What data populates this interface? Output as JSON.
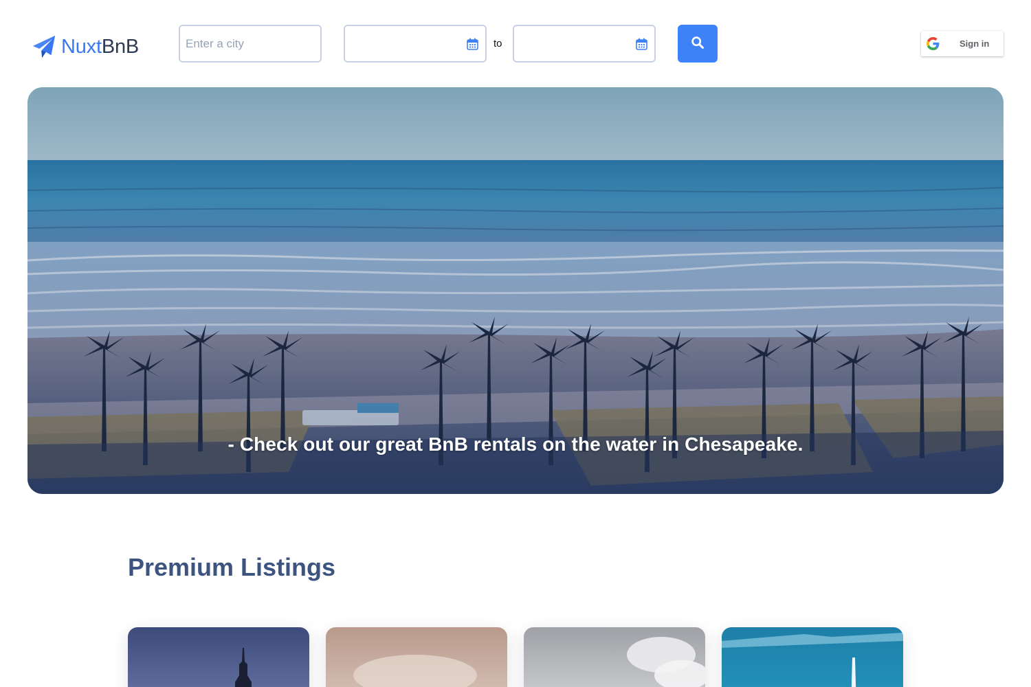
{
  "brand": {
    "part1": "Nuxt",
    "part2": "BnB"
  },
  "search": {
    "city_placeholder": "Enter a city",
    "city_value": "",
    "checkin_value": "",
    "checkout_value": "",
    "to_label": "to"
  },
  "auth": {
    "google_sign_in": "Sign in"
  },
  "hero": {
    "caption": "- Check out our great BnB rentals on the water in Chesapeake."
  },
  "listings": {
    "title": "Premium Listings"
  },
  "colors": {
    "accent": "#3d82f7",
    "heading": "#3e5480",
    "brand_dark": "#2b3a55"
  },
  "icons": [
    "logo-plane-icon",
    "calendar-icon",
    "search-icon",
    "google-icon"
  ]
}
